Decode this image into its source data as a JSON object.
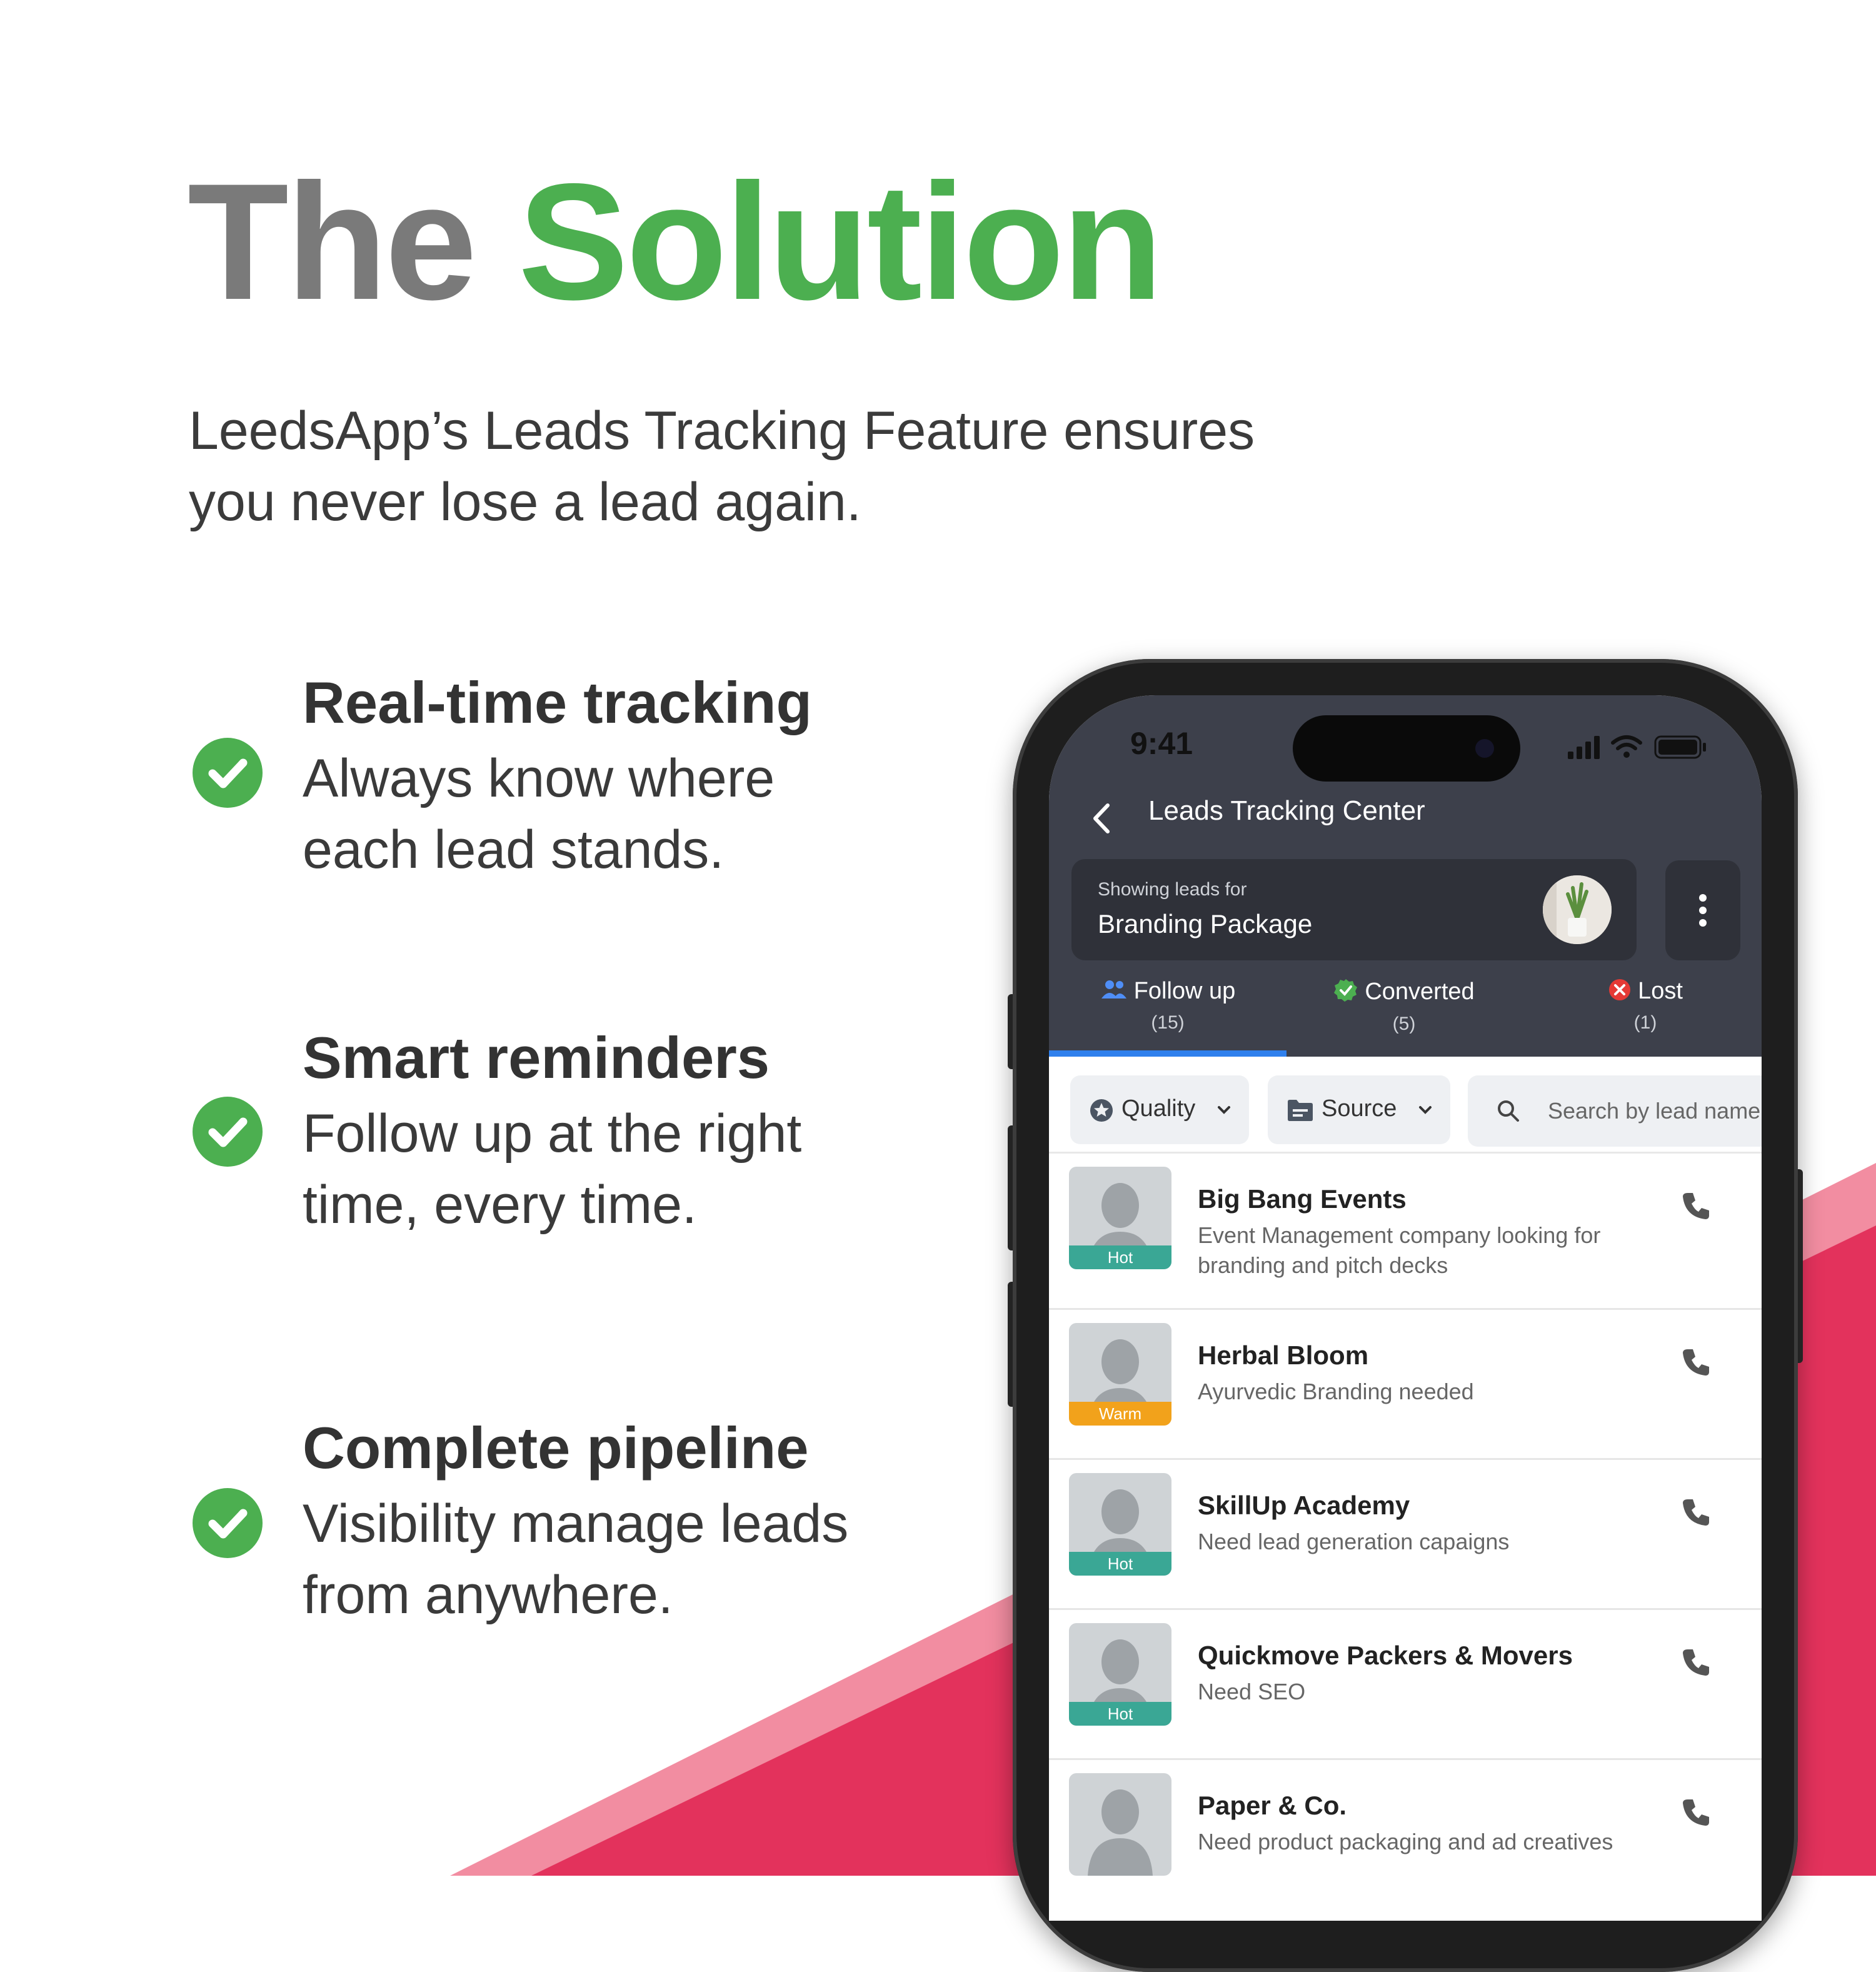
{
  "headline": {
    "part1": "The",
    "part2": "Solution"
  },
  "intro": {
    "line1": "LeedsApp’s Leads Tracking Feature ensures",
    "line2": "you never lose a lead again."
  },
  "features": [
    {
      "title": "Real-time tracking",
      "line1": "Always know where",
      "line2": "each lead stands."
    },
    {
      "title": "Smart reminders",
      "line1": "Follow up at the right",
      "line2": "time, every time."
    },
    {
      "title": "Complete pipeline",
      "line1": "Visibility manage leads",
      "line2": "from anywhere."
    }
  ],
  "colors": {
    "accent_green": "#4caf50",
    "header_dark": "#3d404b",
    "wedge_red": "#e3325c",
    "wedge_pink": "#f28da1",
    "tab_blue": "#2f80ed",
    "hot": "#3aa795",
    "warm": "#f2a21b",
    "lost_red": "#e53935"
  },
  "phone": {
    "status": {
      "time": "9:41",
      "icons": [
        "signal-icon",
        "wifi-icon",
        "battery-icon"
      ]
    },
    "app": {
      "title": "Leads Tracking Center",
      "context_caption": "Showing leads for",
      "context_value": "Branding Package",
      "tabs": [
        {
          "label": "Follow up",
          "count": "(15)",
          "icon": "people-icon"
        },
        {
          "label": "Converted",
          "count": "(5)",
          "icon": "check-badge-icon"
        },
        {
          "label": "Lost",
          "count": "(1)",
          "icon": "x-circle-icon"
        }
      ],
      "filters": {
        "quality": "Quality",
        "source": "Source",
        "search_placeholder": "Search by lead name"
      },
      "leads": [
        {
          "name": "Big Bang Events",
          "desc": "Event Management company looking for branding and pitch decks",
          "tag": "Hot"
        },
        {
          "name": "Herbal Bloom",
          "desc": "Ayurvedic Branding needed",
          "tag": "Warm"
        },
        {
          "name": "SkillUp Academy",
          "desc": "Need lead generation capaigns",
          "tag": "Hot"
        },
        {
          "name": "Quickmove Packers & Movers",
          "desc": "Need SEO",
          "tag": "Hot"
        },
        {
          "name": "Paper & Co.",
          "desc": "Need product packaging and ad creatives",
          "tag": ""
        }
      ]
    }
  }
}
